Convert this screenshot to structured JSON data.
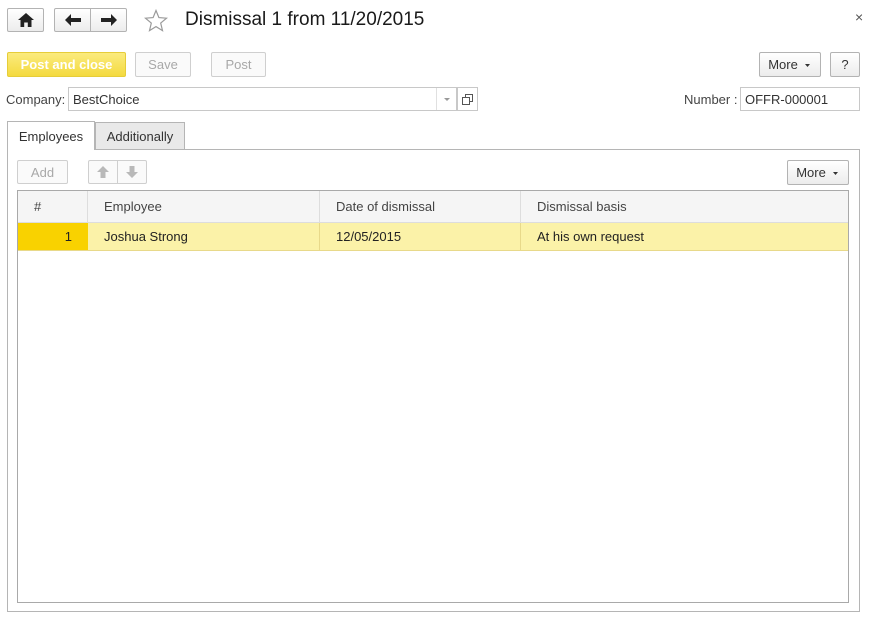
{
  "window": {
    "title": "Dismissal 1 from 11/20/2015",
    "close_glyph": "×"
  },
  "nav": {
    "home_icon": "home-icon",
    "back_icon": "arrow-left-icon",
    "forward_icon": "arrow-right-icon",
    "favorite_icon": "star-outline-icon"
  },
  "toolbar": {
    "post_and_close_label": "Post and close",
    "save_label": "Save",
    "post_label": "Post",
    "more_label": "More",
    "help_label": "?"
  },
  "form": {
    "company_label": "Company:",
    "company_value": "BestChoice",
    "number_label": "Number :",
    "number_value": "OFFR-000001"
  },
  "tabs": [
    {
      "label": "Employees",
      "active": true
    },
    {
      "label": "Additionally",
      "active": false
    }
  ],
  "table_toolbar": {
    "add_label": "Add",
    "more_label": "More"
  },
  "table": {
    "columns": [
      "#",
      "Employee",
      "Date of dismissal",
      "Dismissal basis"
    ],
    "rows": [
      {
        "num": "1",
        "employee": "Joshua Strong",
        "date": "12/05/2015",
        "basis": "At his own request"
      }
    ]
  },
  "colors": {
    "primary_button": "#f4da3f",
    "selected_row": "#fbf2a8",
    "row_number_highlight": "#f9d200"
  }
}
